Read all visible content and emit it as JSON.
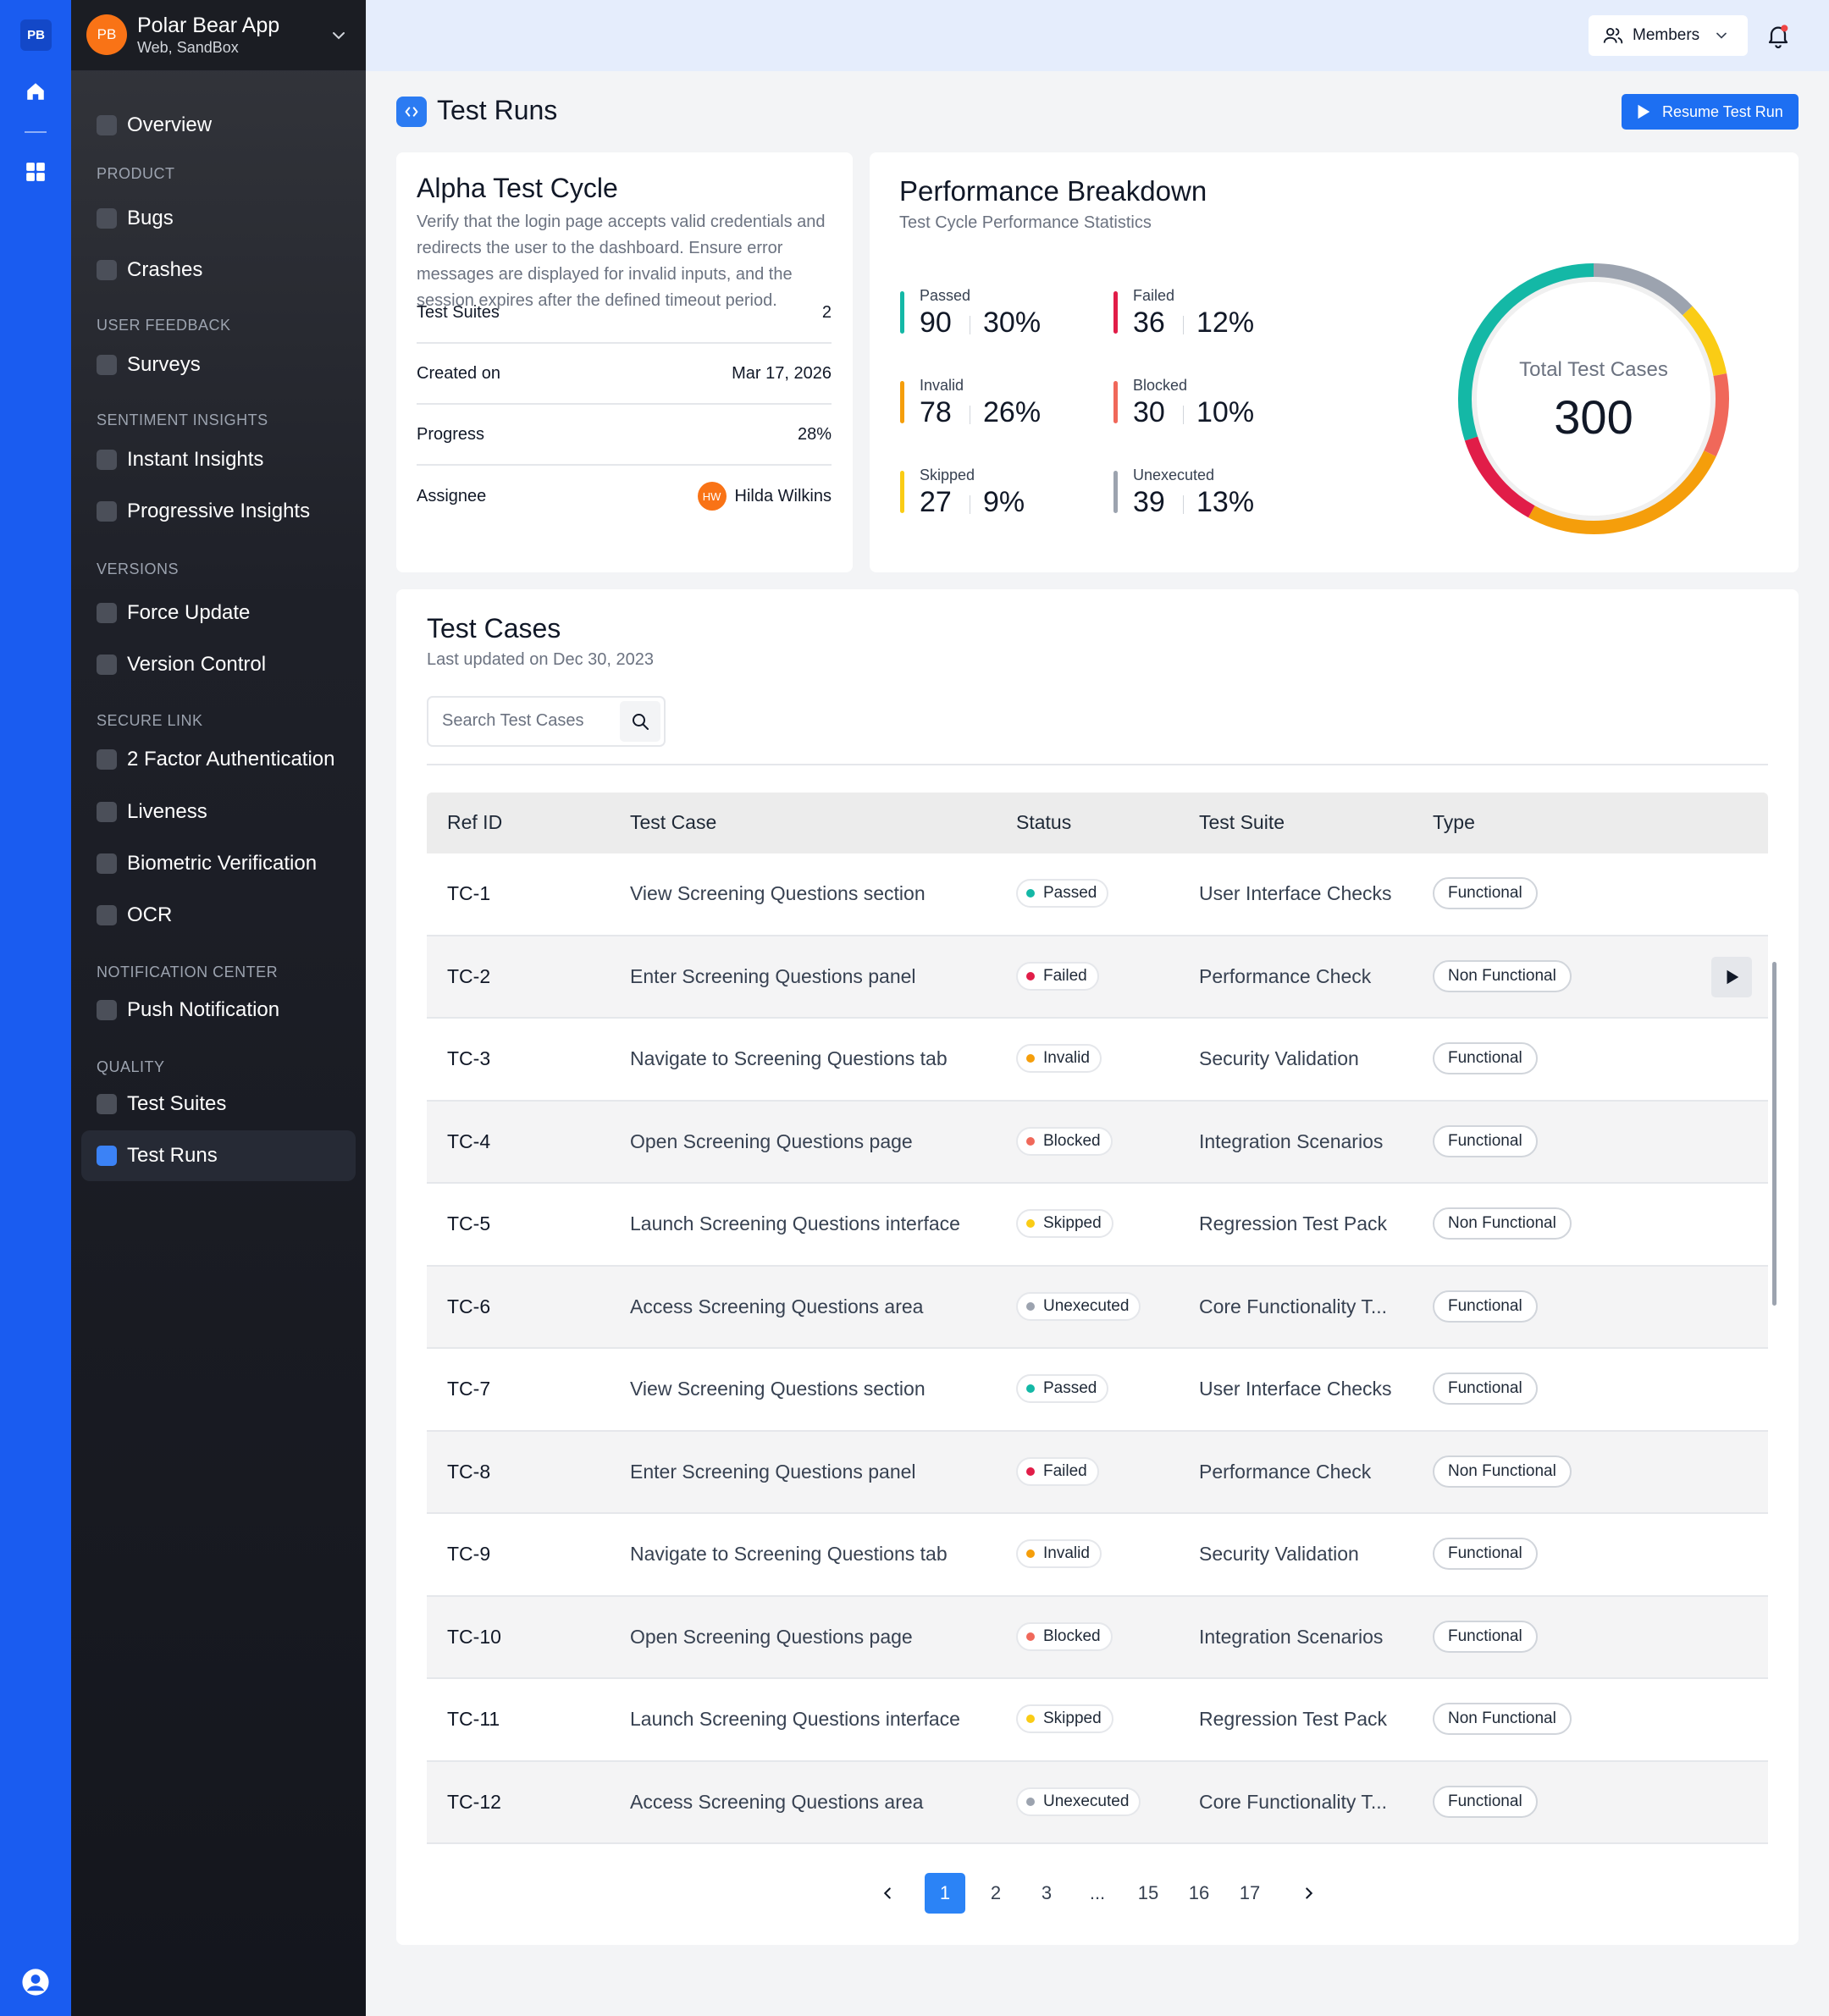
{
  "rail": {
    "logo": "PB"
  },
  "sidebar": {
    "avatar": "PB",
    "app_name": "Polar Bear App",
    "env": "Web, SandBox",
    "items": [
      {
        "label": "Overview"
      },
      {
        "section": "PRODUCT"
      },
      {
        "label": "Bugs"
      },
      {
        "label": "Crashes"
      },
      {
        "section": "USER FEEDBACK"
      },
      {
        "label": "Surveys"
      },
      {
        "section": "SENTIMENT INSIGHTS"
      },
      {
        "label": "Instant Insights"
      },
      {
        "label": "Progressive Insights"
      },
      {
        "section": "VERSIONS"
      },
      {
        "label": "Force Update"
      },
      {
        "label": "Version Control"
      },
      {
        "section": "SECURE LINK"
      },
      {
        "label": "2 Factor Authentication"
      },
      {
        "label": "Liveness"
      },
      {
        "label": "Biometric Verification"
      },
      {
        "label": "OCR"
      },
      {
        "section": "NOTIFICATION CENTER"
      },
      {
        "label": "Push Notification"
      },
      {
        "section": "QUALITY"
      },
      {
        "label": "Test Suites"
      },
      {
        "label": "Test Runs",
        "active": true
      }
    ]
  },
  "header": {
    "members_label": "Members"
  },
  "page": {
    "title": "Test Runs",
    "resume_label": "Resume Test Run"
  },
  "cycle": {
    "title": "Alpha Test Cycle",
    "description": "Verify that the login page accepts valid credentials and redirects the user to the dashboard. Ensure error messages are displayed for invalid inputs, and the session expires after the defined timeout period.",
    "rows": [
      {
        "label": "Test Suites",
        "value": "2"
      },
      {
        "label": "Created on",
        "value": "Mar 17, 2026"
      },
      {
        "label": "Progress",
        "value": "28%"
      },
      {
        "label": "Assignee",
        "value": "Hilda Wilkins",
        "avatar": "HW"
      }
    ]
  },
  "performance": {
    "title": "Performance Breakdown",
    "subtitle": "Test Cycle Performance Statistics",
    "stats": [
      {
        "label": "Passed",
        "count": "90",
        "pct": "30%",
        "color": "#14b8a6"
      },
      {
        "label": "Failed",
        "count": "36",
        "pct": "12%",
        "color": "#e11d48"
      },
      {
        "label": "Invalid",
        "count": "78",
        "pct": "26%",
        "color": "#f59e0b"
      },
      {
        "label": "Blocked",
        "count": "30",
        "pct": "10%",
        "color": "#f0685a"
      },
      {
        "label": "Skipped",
        "count": "27",
        "pct": "9%",
        "color": "#facc15"
      },
      {
        "label": "Unexecuted",
        "count": "39",
        "pct": "13%",
        "color": "#9ca3af"
      }
    ],
    "donut_label": "Total Test Cases",
    "donut_total": "300",
    "donut_order": [
      "Unexecuted",
      "Skipped",
      "Blocked",
      "Invalid",
      "Failed",
      "Passed"
    ]
  },
  "test_cases": {
    "title": "Test Cases",
    "subtitle": "Last updated on Dec 30, 2023",
    "search_placeholder": "Search Test Cases",
    "columns": [
      "Ref ID",
      "Test Case",
      "Status",
      "Test Suite",
      "Type"
    ],
    "status_colors": {
      "Passed": "#14b8a6",
      "Failed": "#e11d48",
      "Invalid": "#f59e0b",
      "Blocked": "#f0685a",
      "Skipped": "#facc15",
      "Unexecuted": "#9ca3af"
    },
    "rows": [
      {
        "id": "TC-1",
        "name": "View Screening Questions section",
        "status": "Passed",
        "suite": "User Interface Checks",
        "type": "Functional"
      },
      {
        "id": "TC-2",
        "name": "Enter Screening Questions panel",
        "status": "Failed",
        "suite": "Performance Check",
        "type": "Non Functional",
        "play": true
      },
      {
        "id": "TC-3",
        "name": "Navigate to Screening Questions tab",
        "status": "Invalid",
        "suite": "Security Validation",
        "type": "Functional"
      },
      {
        "id": "TC-4",
        "name": "Open Screening Questions page",
        "status": "Blocked",
        "suite": "Integration Scenarios",
        "type": "Functional"
      },
      {
        "id": "TC-5",
        "name": "Launch Screening Questions interface",
        "status": "Skipped",
        "suite": "Regression Test Pack",
        "type": "Non Functional"
      },
      {
        "id": "TC-6",
        "name": "Access Screening Questions area",
        "status": "Unexecuted",
        "suite": "Core Functionality T...",
        "type": "Functional"
      },
      {
        "id": "TC-7",
        "name": "View Screening Questions section",
        "status": "Passed",
        "suite": "User Interface Checks",
        "type": "Functional"
      },
      {
        "id": "TC-8",
        "name": "Enter Screening Questions panel",
        "status": "Failed",
        "suite": "Performance Check",
        "type": "Non Functional"
      },
      {
        "id": "TC-9",
        "name": "Navigate to Screening Questions tab",
        "status": "Invalid",
        "suite": "Security Validation",
        "type": "Functional"
      },
      {
        "id": "TC-10",
        "name": "Open Screening Questions page",
        "status": "Blocked",
        "suite": "Integration Scenarios",
        "type": "Functional"
      },
      {
        "id": "TC-11",
        "name": "Launch Screening Questions interface",
        "status": "Skipped",
        "suite": "Regression Test Pack",
        "type": "Non Functional"
      },
      {
        "id": "TC-12",
        "name": "Access Screening Questions area",
        "status": "Unexecuted",
        "suite": "Core Functionality T...",
        "type": "Functional"
      }
    ]
  },
  "pagination": {
    "pages": [
      "1",
      "2",
      "3",
      "...",
      "15",
      "16",
      "17"
    ],
    "current": "1"
  }
}
